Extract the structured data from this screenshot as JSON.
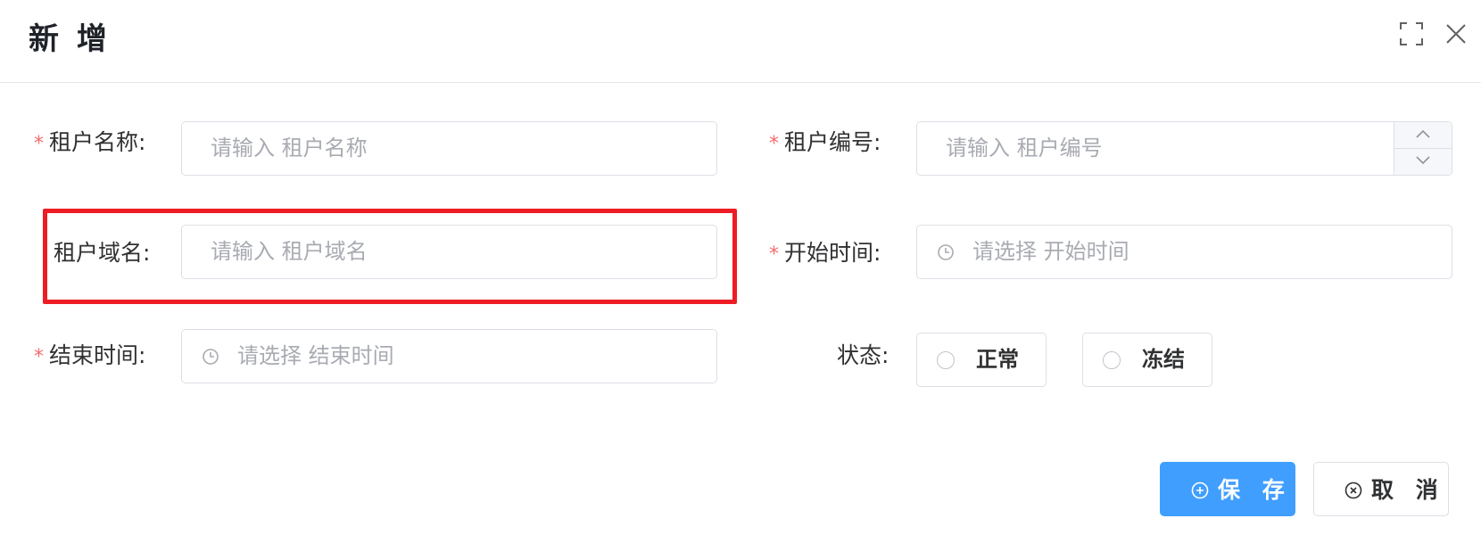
{
  "dialog": {
    "title": "新 增",
    "fullscreen_icon": "fullscreen-icon",
    "close_icon": "close-icon"
  },
  "form": {
    "required_mark": "*",
    "tenant_name": {
      "label": "租户名称:",
      "placeholder": "请输入 租户名称",
      "required": true
    },
    "tenant_code": {
      "label": "租户编号:",
      "placeholder": "请输入 租户编号",
      "required": true
    },
    "tenant_domain": {
      "label": "租户域名:",
      "placeholder": "请输入 租户域名",
      "required": false
    },
    "start_time": {
      "label": "开始时间:",
      "placeholder": "请选择 开始时间",
      "required": true,
      "icon": "clock-icon"
    },
    "end_time": {
      "label": "结束时间:",
      "placeholder": "请选择 结束时间",
      "required": true,
      "icon": "clock-icon"
    },
    "status": {
      "label": "状态:",
      "options": [
        "正常",
        "冻结"
      ],
      "selected": null
    }
  },
  "footer": {
    "save_label": "保 存",
    "cancel_label": "取 消",
    "save_icon": "plus-circle-icon",
    "cancel_icon": "x-circle-icon"
  },
  "colors": {
    "primary": "#409eff",
    "required": "#f56c6c",
    "highlight": "#ee1c25"
  }
}
